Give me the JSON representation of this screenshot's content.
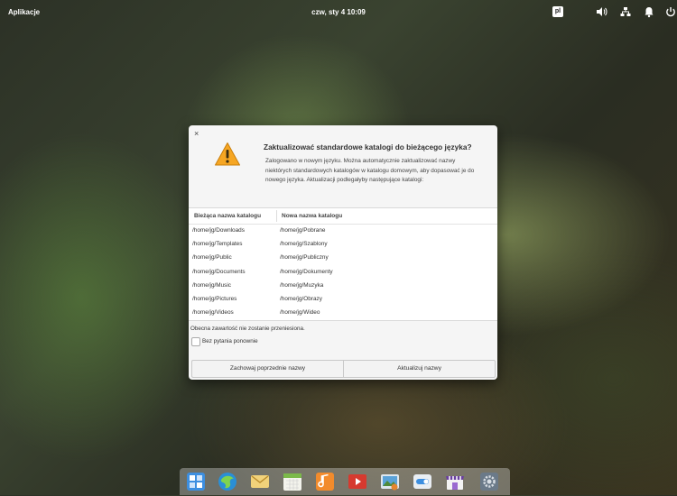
{
  "panel": {
    "applications": "Aplikacje",
    "clock": "czw, sty  4    10:09",
    "language": "pl",
    "indicators": [
      "volume-icon",
      "network-icon",
      "notifications-icon",
      "power-icon"
    ]
  },
  "dialog": {
    "close": "×",
    "title": "Zaktualizować standardowe katalogi do bieżącego języka?",
    "description": "Zalogowano w nowym języku. Można automatycznie zaktualizować nazwy niektórych standardowych katalogów w katalogu domowym, aby dopasować je do nowego języka. Aktualizacji podlegałyby następujące katalogi:",
    "table": {
      "headers": [
        "Bieżąca nazwa katalogu",
        "Nowa nazwa katalogu"
      ],
      "rows": [
        [
          "/home/jg/Downloads",
          "/home/jg/Pobrane"
        ],
        [
          "/home/jg/Templates",
          "/home/jg/Szablony"
        ],
        [
          "/home/jg/Public",
          "/home/jg/Publiczny"
        ],
        [
          "/home/jg/Documents",
          "/home/jg/Dokumenty"
        ],
        [
          "/home/jg/Music",
          "/home/jg/Muzyka"
        ],
        [
          "/home/jg/Pictures",
          "/home/jg/Obrazy"
        ],
        [
          "/home/jg/Videos",
          "/home/jg/Wideo"
        ]
      ]
    },
    "note": "Obecna zawartość nie zostanie przeniesiona.",
    "checkbox_label": "Bez pytania ponownie",
    "keep_button": "Zachowaj poprzednie nazwy",
    "update_button": "Aktualizuj nazwy"
  },
  "dock": {
    "apps": [
      "multitasking-view",
      "web-browser",
      "mail",
      "calendar",
      "music",
      "videos",
      "photos",
      "system-settings-toggle",
      "appcenter",
      "settings"
    ]
  },
  "colors": {
    "warning": "#f5a623",
    "dialog_bg": "#f5f5f5"
  }
}
